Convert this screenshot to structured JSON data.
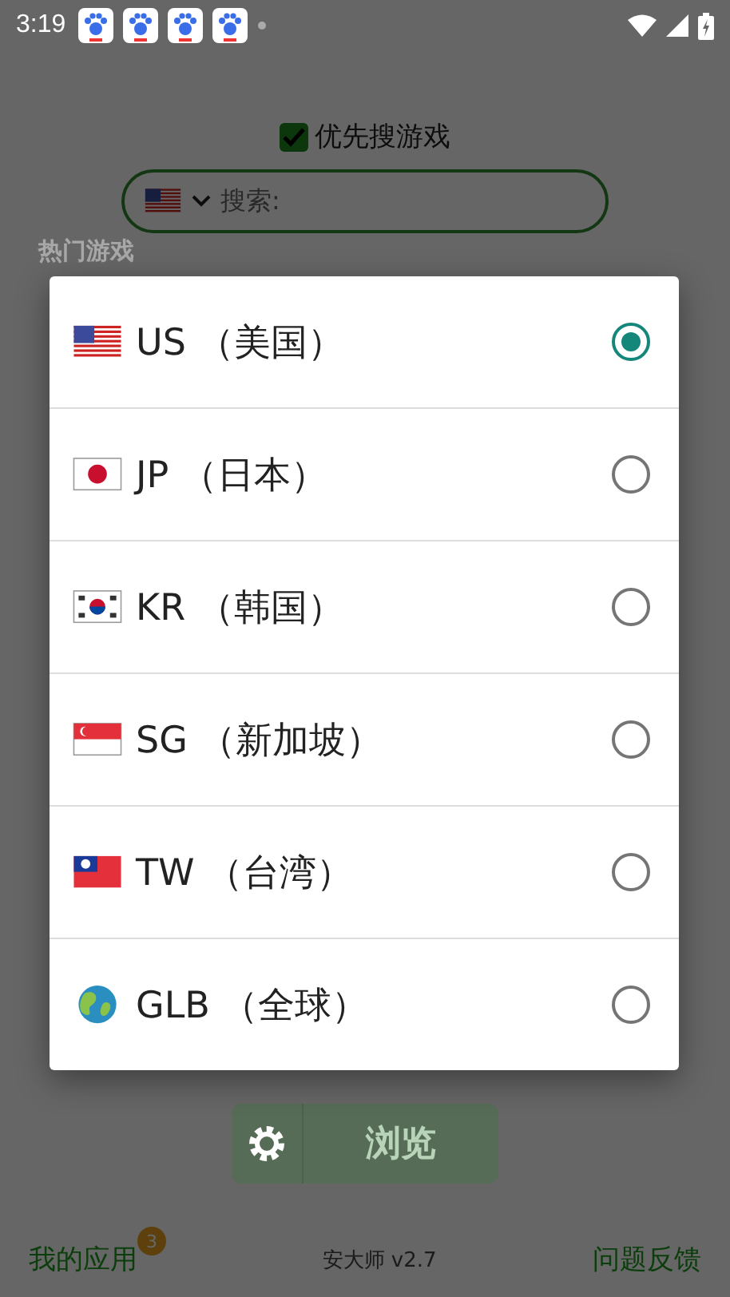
{
  "status_bar": {
    "time": "3:19",
    "notifications": [
      {
        "kind": "paw"
      },
      {
        "kind": "paw"
      },
      {
        "kind": "paw"
      },
      {
        "kind": "paw"
      }
    ]
  },
  "app": {
    "prefer_games": {
      "label": "优先搜游戏",
      "checked": true
    },
    "search": {
      "flag": {
        "kind": "usa"
      },
      "placeholder": "搜索:"
    },
    "section_title": "热门游戏",
    "browse_button": "浏览",
    "footer": {
      "my_apps": "我的应用",
      "badge": "3",
      "version": "安大师 v2.7",
      "feedback": "问题反馈"
    }
  },
  "dialog": {
    "options": [
      {
        "kind": "usa",
        "label": "US （美国）",
        "selected": true
      },
      {
        "kind": "japan",
        "label": "JP （日本）",
        "selected": false
      },
      {
        "kind": "korea",
        "label": "KR （韩国）",
        "selected": false
      },
      {
        "kind": "singapore",
        "label": "SG （新加坡）",
        "selected": false
      },
      {
        "kind": "taiwan",
        "label": "TW （台湾）",
        "selected": false
      },
      {
        "kind": "globe",
        "label": "GLB （全球）",
        "selected": false
      }
    ]
  }
}
